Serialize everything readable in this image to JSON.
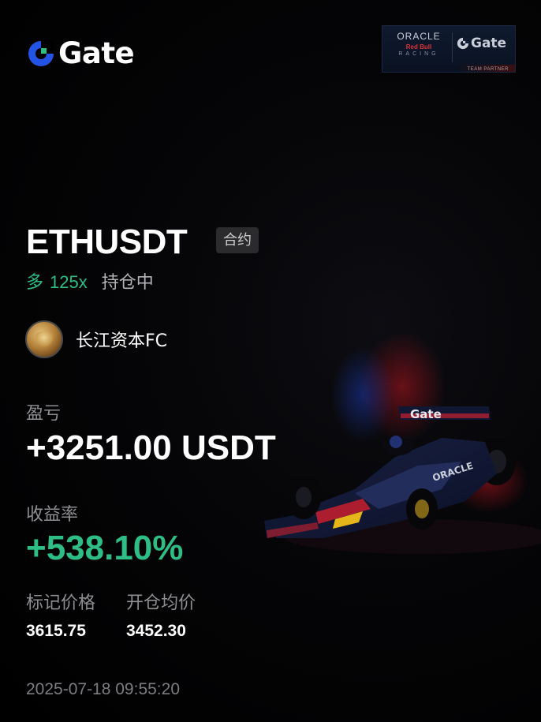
{
  "brand": {
    "name": "Gate",
    "logo_icon": "gate-logo-icon",
    "accent": "#2354e6",
    "accent_green": "#2ebd85"
  },
  "partner_badge": {
    "oracle": "ORACLE",
    "redbull": "Red Bull",
    "racing": "RACING",
    "gate": "Gate",
    "footer": "TEAM PARTNER"
  },
  "position": {
    "pair": "ETHUSDT",
    "type_tag": "合约",
    "side": "多",
    "leverage": "125x",
    "status": "持仓中"
  },
  "user": {
    "name": "长江资本FC",
    "avatar_icon": "avatar-icon"
  },
  "pnl": {
    "label": "盈亏",
    "value": "+3251.00 USDT"
  },
  "roi": {
    "label": "收益率",
    "value": "+538.10%"
  },
  "prices": {
    "mark_label": "标记价格",
    "mark_value": "3615.75",
    "entry_label": "开仓均价",
    "entry_value": "3452.30"
  },
  "timestamp": "2025-07-18 09:55:20"
}
